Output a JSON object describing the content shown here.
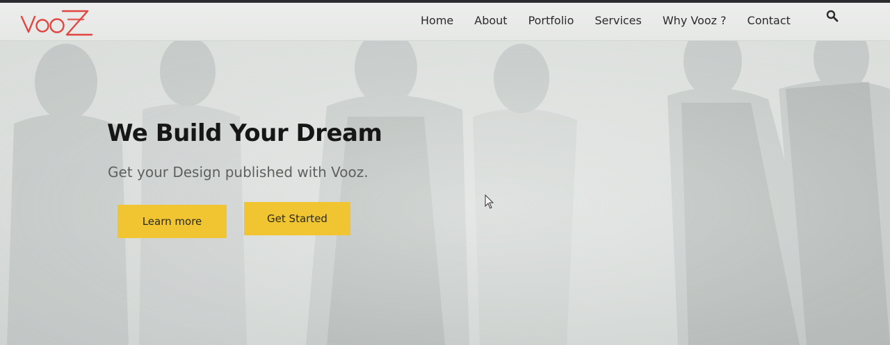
{
  "brand": {
    "logo_text": "VooZ",
    "logo_color": "#e2453f"
  },
  "nav": {
    "items": [
      {
        "label": "Home"
      },
      {
        "label": "About"
      },
      {
        "label": "Portfolio"
      },
      {
        "label": "Services"
      },
      {
        "label": "Why Vooz ?"
      },
      {
        "label": "Contact"
      }
    ],
    "search_icon": "search-icon"
  },
  "hero": {
    "title": "We Build Your Dream",
    "subtitle": "Get your Design published with Vooz.",
    "buttons": {
      "learn_more": "Learn more",
      "get_started": "Get Started"
    },
    "button_color": "#f0c531",
    "background_image": "grayscale group of people"
  }
}
